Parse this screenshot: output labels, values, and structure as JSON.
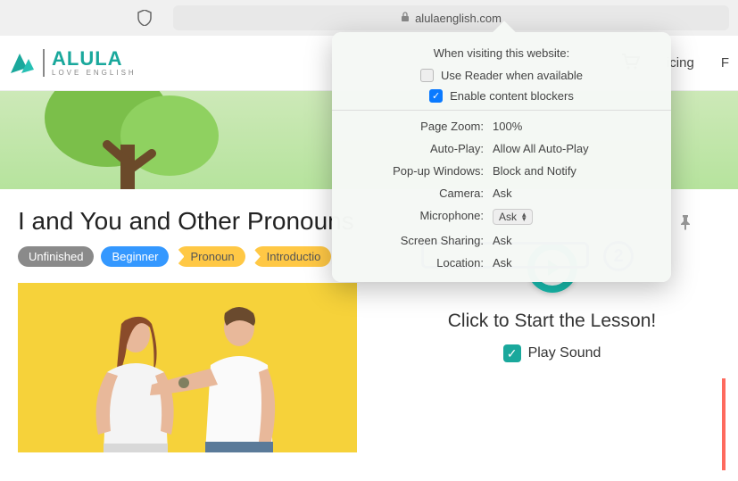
{
  "browser": {
    "domain": "alulaenglish.com"
  },
  "header": {
    "logo_title": "ALULA",
    "logo_sub": "LOVE ENGLISH",
    "nav_pricing": "icing",
    "nav_f": "F"
  },
  "lesson": {
    "title": "I and You and Other Pronouns",
    "tags": {
      "status": "Unfinished",
      "level": "Beginner",
      "topic1": "Pronoun",
      "topic2": "Introductio"
    }
  },
  "right_panel": {
    "start_text": "Click to Start the Lesson!",
    "play_sound": "Play Sound"
  },
  "popover": {
    "heading": "When visiting this website:",
    "reader": "Use Reader when available",
    "blockers": "Enable content blockers",
    "rows": {
      "zoom_label": "Page Zoom:",
      "zoom_val": "100%",
      "autoplay_label": "Auto-Play:",
      "autoplay_val": "Allow All Auto-Play",
      "popup_label": "Pop-up Windows:",
      "popup_val": "Block and Notify",
      "camera_label": "Camera:",
      "camera_val": "Ask",
      "mic_label": "Microphone:",
      "mic_val": "Ask",
      "share_label": "Screen Sharing:",
      "share_val": "Ask",
      "location_label": "Location:",
      "location_val": "Ask"
    }
  },
  "annotation": {
    "number": "2"
  }
}
